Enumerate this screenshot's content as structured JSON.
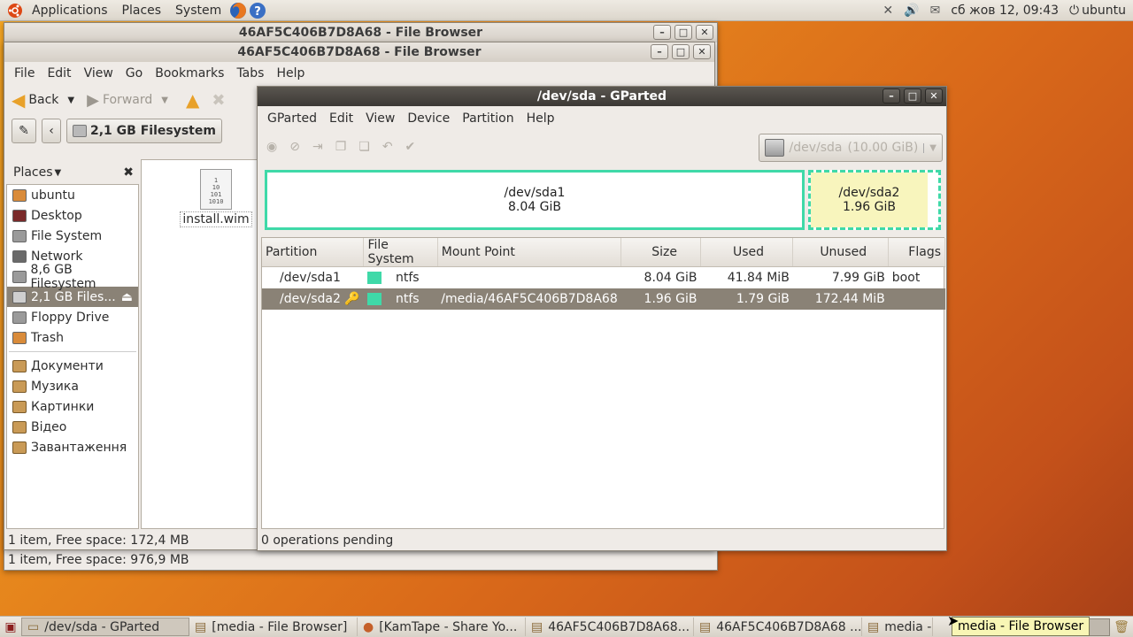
{
  "top_panel": {
    "applications": "Applications",
    "places": "Places",
    "system": "System",
    "clock": "сб жов 12, 09:43",
    "user": "ubuntu"
  },
  "nautilus_back": {
    "title": "46AF5C406B7D8A68 - File Browser",
    "status": "1 item, Free space: 976,9 MB"
  },
  "nautilus_front": {
    "title": "46AF5C406B7D8A68 - File Browser",
    "menu": [
      "File",
      "Edit",
      "View",
      "Go",
      "Bookmarks",
      "Tabs",
      "Help"
    ],
    "toolbar": {
      "back": "Back",
      "forward": "Forward"
    },
    "location": "2,1 GB Filesystem",
    "places_label": "Places",
    "places": [
      {
        "label": "ubuntu",
        "icon": "home-icon",
        "color": "#d98b3a"
      },
      {
        "label": "Desktop",
        "icon": "desktop-icon",
        "color": "#7a2a2a"
      },
      {
        "label": "File System",
        "icon": "drive-icon",
        "color": "#9a9a9a"
      },
      {
        "label": "Network",
        "icon": "network-icon",
        "color": "#6a6a6a"
      },
      {
        "label": "8,6 GB Filesystem",
        "icon": "drive-icon",
        "color": "#9a9a9a"
      },
      {
        "label": "2,1 GB Files...",
        "icon": "drive-icon",
        "color": "#cfcfcf",
        "selected": true
      },
      {
        "label": "Floppy Drive",
        "icon": "floppy-icon",
        "color": "#9a9a9a"
      },
      {
        "label": "Trash",
        "icon": "trash-icon",
        "color": "#d98b3a"
      }
    ],
    "bookmarks": [
      {
        "label": "Документи",
        "icon": "folder-icon"
      },
      {
        "label": "Музика",
        "icon": "folder-icon"
      },
      {
        "label": "Картинки",
        "icon": "folder-icon"
      },
      {
        "label": "Відео",
        "icon": "folder-icon"
      },
      {
        "label": "Завантаження",
        "icon": "folder-icon"
      }
    ],
    "file": {
      "name": "install.wim",
      "icon_text": "1\n10\n101\n1010"
    },
    "status": "1 item, Free space: 172,4 MB"
  },
  "gparted": {
    "title": "/dev/sda - GParted",
    "menu": [
      "GParted",
      "Edit",
      "View",
      "Device",
      "Partition",
      "Help"
    ],
    "device": "/dev/sda",
    "device_size": "(10.00 GiB)",
    "map": [
      {
        "name": "/dev/sda1",
        "size": "8.04 GiB"
      },
      {
        "name": "/dev/sda2",
        "size": "1.96 GiB"
      }
    ],
    "columns": [
      "Partition",
      "File System",
      "Mount Point",
      "Size",
      "Used",
      "Unused",
      "Flags"
    ],
    "rows": [
      {
        "partition": "/dev/sda1",
        "fs": "ntfs",
        "mount": "",
        "size": "8.04 GiB",
        "used": "41.84 MiB",
        "unused": "7.99 GiB",
        "flags": "boot",
        "selected": false
      },
      {
        "partition": "/dev/sda2",
        "fs": "ntfs",
        "mount": "/media/46AF5C406B7D8A68",
        "size": "1.96 GiB",
        "used": "1.79 GiB",
        "unused": "172.44 MiB",
        "flags": "",
        "selected": true
      }
    ],
    "fs_color": "#3fd9a8",
    "status": "0 operations pending"
  },
  "taskbar": [
    {
      "label": "/dev/sda - GParted",
      "active": true
    },
    {
      "label": "[media - File Browser]",
      "active": false
    },
    {
      "label": "[KamTape - Share Yo...",
      "active": false
    },
    {
      "label": "46AF5C406B7D8A68...",
      "active": false
    },
    {
      "label": "46AF5C406B7D8A68 ...",
      "active": false
    },
    {
      "label": "media -",
      "active": false
    }
  ],
  "tooltip": "media - File Browser"
}
